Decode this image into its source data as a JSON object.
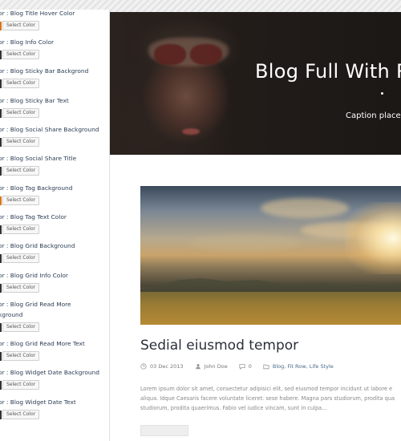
{
  "options": [
    {
      "label": "or : Blog Title Hover Color",
      "button": "Select Color",
      "swatch": "#d9761c"
    },
    {
      "label": "or : Blog Info Color",
      "button": "Select Color",
      "swatch": "#2c2c2c"
    },
    {
      "label": "or : Blog Sticky Bar Backgrond",
      "button": "Select Color",
      "swatch": "#2c2c2c"
    },
    {
      "label": "or : Blog Sticky Bar Text",
      "button": "Select Color",
      "swatch": "#2c2c2c"
    },
    {
      "label": "or : Blog Social Share Background",
      "button": "Select Color",
      "swatch": "#2c2c2c"
    },
    {
      "label": "or : Blog Social Share Title",
      "button": "Select Color",
      "swatch": "#2c2c2c"
    },
    {
      "label": "or : Blog Tag Background",
      "button": "Select Color",
      "swatch": "#d9761c"
    },
    {
      "label": "or : Blog Tag Text Color",
      "button": "Select Color",
      "swatch": "#2c2c2c"
    },
    {
      "label": "or : Blog Grid Background",
      "button": "Select Color",
      "swatch": "#2c2c2c"
    },
    {
      "label": "or : Blog Grid Info Color",
      "button": "Select Color",
      "swatch": "#2c2c2c"
    },
    {
      "label": "or : Blog Grid Read More",
      "label2": "kground",
      "button": "Select Color",
      "swatch": "#2c2c2c"
    },
    {
      "label": "or : Blog Grid Read More Text",
      "button": "Select Color",
      "swatch": "#2c2c2c"
    },
    {
      "label": "or : Blog Widget Date Background",
      "button": "Select Color",
      "swatch": "#2c2c2c"
    },
    {
      "label": "or : Blog Widget Date Text",
      "button": "Select Color",
      "swatch": "#2c2c2c"
    }
  ],
  "hero": {
    "title": "Blog Full With R",
    "caption": "Caption placed"
  },
  "post": {
    "title": "Sedial eiusmod tempor",
    "date": "03 Dec 2013",
    "author": "John Doe",
    "comments": "0",
    "categories": "Blog, Fit Row, Life Style",
    "excerpt": [
      "Lorem ipsum dolor sit amet, consectetur adipisici elit, sed eiusmod tempor incidunt ut labore e",
      "aliqua. Idque Caesaris facere voluntate liceret: sese habere. Magna pars studiorum, prodita qua",
      "studiorum, prodita quaerimus. Fabio vel iudice vincam, sunt in culpa..."
    ]
  },
  "colors": {
    "accent_orange": "#d9761c",
    "swatch_dark": "#2c2c2c",
    "label_text": "#2b3d55",
    "title_text": "#2a2f38"
  }
}
